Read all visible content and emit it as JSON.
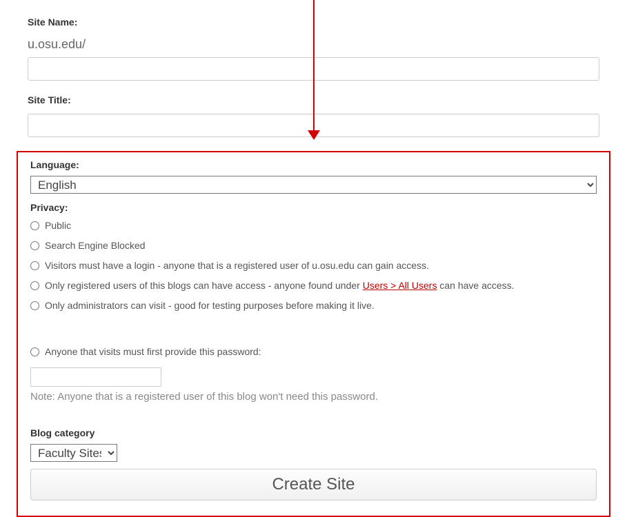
{
  "siteName": {
    "label": "Site Name:",
    "prefix": "u.osu.edu/",
    "value": ""
  },
  "siteTitle": {
    "label": "Site Title:",
    "value": ""
  },
  "language": {
    "label": "Language:",
    "selected": "English"
  },
  "privacy": {
    "label": "Privacy:",
    "options": {
      "public": "Public",
      "searchBlocked": "Search Engine Blocked",
      "loginRequired": "Visitors must have a login - anyone that is a registered user of u.osu.edu can gain access.",
      "registeredOnly_pre": "Only registered users of this blogs can have access - anyone found under ",
      "registeredOnly_link": "Users > All Users",
      "registeredOnly_post": " can have access.",
      "adminsOnly": "Only administrators can visit - good for testing purposes before making it live.",
      "passwordRequired": "Anyone that visits must first provide this password:"
    },
    "passwordValue": "",
    "note": "Note: Anyone that is a registered user of this blog won't need this password."
  },
  "blogCategory": {
    "label": "Blog category",
    "selected": "Faculty Sites"
  },
  "buttons": {
    "createSite": "Create Site"
  }
}
